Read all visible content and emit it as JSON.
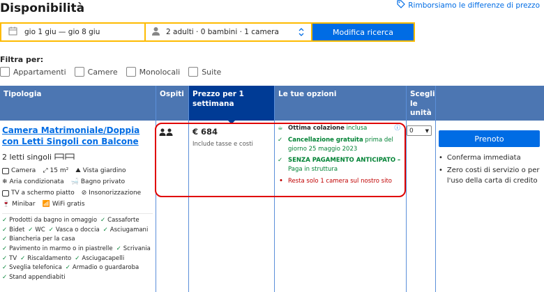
{
  "page": {
    "title": "Disponibilità",
    "price_match": "Rimborsiamo le differenze di prezzo"
  },
  "search": {
    "dates": "gio 1 giu — gio 8 giu",
    "occupancy": "2 adulti · 0 bambini · 1 camera",
    "button": "Modifica ricerca"
  },
  "filters": {
    "label": "Filtra per:",
    "options": [
      "Appartamenti",
      "Camere",
      "Monolocali",
      "Suite"
    ]
  },
  "table": {
    "headers": {
      "type": "Tipologia",
      "guests": "Ospiti",
      "price": "Prezzo per 1 settimana",
      "options": "Le tue opzioni",
      "choose": "Scegli le unità"
    }
  },
  "room": {
    "name": "Camera Matrimoniale/Doppia con Letti Singoli con Balcone",
    "beds": "2 letti singoli",
    "facilities": [
      "Camera",
      "15 m²",
      "Vista giardino",
      "Aria condizionata",
      "Bagno privato",
      "TV a schermo piatto",
      "Insonorizzazione",
      "Minibar",
      "WiFi gratis"
    ],
    "amenities": [
      "Prodotti da bagno in omaggio",
      "Cassaforte",
      "Bidet",
      "WC",
      "Vasca o doccia",
      "Asciugamani",
      "Biancheria per la casa",
      "Pavimento in marmo o in piastrelle",
      "Scrivania",
      "TV",
      "Riscaldamento",
      "Asciugacapelli",
      "Sveglia telefonica",
      "Armadio o guardaroba",
      "Stand appendiabiti"
    ]
  },
  "price": {
    "amount": "€ 684",
    "note": "Include tasse e costi"
  },
  "options": {
    "breakfast_bold": "Ottima colazione",
    "breakfast_rest": "inclusa",
    "cancel_bold": "Cancellazione gratuita",
    "cancel_rest": "prima del giorno 25 maggio 2023",
    "prepay_bold": "SENZA PAGAMENTO ANTICIPATO",
    "prepay_dash": "–",
    "prepay_rest": "Paga in struttura",
    "scarcity": "Resta solo 1 camera sul nostro sito"
  },
  "select": {
    "value": "0"
  },
  "reserve": {
    "button": "Prenoto",
    "bullets": [
      "Conferma immediata",
      "Zero costi di servizio o per l'uso della carta di credito"
    ]
  },
  "colors": {
    "brand_blue": "#006ce4",
    "header_blue": "#4c76b2",
    "selected_header": "#003b95",
    "highlight_red": "#e00000",
    "yellow": "#febb02",
    "green": "#008234"
  }
}
